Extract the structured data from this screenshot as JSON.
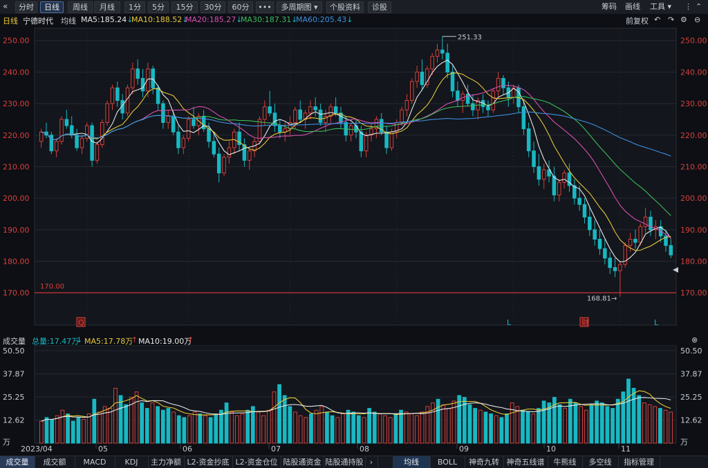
{
  "toolbar": {
    "back_icon": "double-chevron-left-icon",
    "buttons": [
      "分时",
      "日线",
      "周线",
      "月线",
      "1分",
      "5分",
      "15分",
      "30分",
      "60分"
    ],
    "active": "日线",
    "more": "•••",
    "multi_period": "多周期图",
    "stock_info": "个股资料",
    "diagnose": "诊股",
    "right_items": [
      "筹码",
      "画线",
      "工具"
    ]
  },
  "info": {
    "period": "日线",
    "stock_name": "宁德时代",
    "mode": "均线",
    "ma5": "MA5:185.24",
    "ma10": "MA10:188.52",
    "ma20": "MA20:185.27",
    "ma30": "MA30:187.31",
    "ma60": "MA60:205.43",
    "adjust": "前复权"
  },
  "colors": {
    "up": "#d7403d",
    "down": "#19b8c2",
    "ma5": "#e8e8e8",
    "ma10": "#e7c83a",
    "ma20": "#d94fb2",
    "ma30": "#3bbd5a",
    "ma60": "#3e8fe0",
    "support": "#c93636"
  },
  "annotations": {
    "high_label": "251.33",
    "low_label": "168.81",
    "support_label": "170.00",
    "markers": [
      "Q",
      "L",
      "财",
      "L"
    ]
  },
  "volume": {
    "title": "成交量",
    "total": "总量:17.47万",
    "ma5": "MA5:17.78万",
    "ma10": "MA10:19.00万"
  },
  "bottom_tabs": [
    "成交量",
    "成交额",
    "MACD",
    "KDJ",
    "主力净额",
    "L2-资金抄底",
    "L2-资金仓位",
    "陆股通资金",
    "陆股通持股"
  ],
  "bottom_tabs_right": [
    "均线",
    "BOLL",
    "神奇九转",
    "神奇五线谱",
    "牛熊线",
    "多空线",
    "指标管理"
  ],
  "chart_data": [
    {
      "type": "candlestick",
      "title": "宁德时代 日线",
      "y_ticks": [
        "250.00",
        "240.00",
        "230.00",
        "220.00",
        "210.00",
        "200.00",
        "190.00",
        "180.00",
        "170.00"
      ],
      "ylim": [
        165,
        253
      ],
      "x_ticks": [
        "2023/04",
        "05",
        "06",
        "07",
        "08",
        "09",
        "10",
        "11"
      ],
      "ohlc": [
        [
          218,
          222,
          216,
          221
        ],
        [
          221,
          224,
          219,
          220
        ],
        [
          220,
          221,
          214,
          215
        ],
        [
          215,
          219,
          213,
          218
        ],
        [
          218,
          226,
          217,
          225
        ],
        [
          225,
          228,
          222,
          223
        ],
        [
          223,
          226,
          219,
          220
        ],
        [
          220,
          222,
          215,
          216
        ],
        [
          216,
          220,
          214,
          219
        ],
        [
          219,
          224,
          218,
          223
        ],
        [
          223,
          224,
          210,
          212
        ],
        [
          212,
          218,
          211,
          217
        ],
        [
          217,
          225,
          216,
          224
        ],
        [
          224,
          231,
          223,
          230
        ],
        [
          230,
          236,
          228,
          235
        ],
        [
          235,
          237,
          229,
          231
        ],
        [
          231,
          233,
          225,
          227
        ],
        [
          227,
          236,
          226,
          235
        ],
        [
          235,
          243,
          233,
          241
        ],
        [
          241,
          244,
          236,
          238
        ],
        [
          238,
          241,
          232,
          234
        ],
        [
          234,
          243,
          232,
          241
        ],
        [
          241,
          242,
          233,
          235
        ],
        [
          235,
          236,
          228,
          230
        ],
        [
          230,
          231,
          222,
          224
        ],
        [
          224,
          228,
          222,
          226
        ],
        [
          226,
          228,
          220,
          221
        ],
        [
          221,
          223,
          214,
          216
        ],
        [
          216,
          220,
          214,
          219
        ],
        [
          219,
          226,
          218,
          225
        ],
        [
          225,
          229,
          222,
          223
        ],
        [
          223,
          227,
          220,
          226
        ],
        [
          226,
          228,
          221,
          222
        ],
        [
          222,
          224,
          216,
          218
        ],
        [
          218,
          221,
          213,
          214
        ],
        [
          214,
          216,
          205,
          208
        ],
        [
          208,
          214,
          207,
          213
        ],
        [
          213,
          218,
          211,
          216
        ],
        [
          216,
          222,
          214,
          221
        ],
        [
          221,
          224,
          215,
          217
        ],
        [
          217,
          219,
          210,
          212
        ],
        [
          212,
          216,
          209,
          215
        ],
        [
          215,
          219,
          213,
          218
        ],
        [
          218,
          226,
          217,
          225
        ],
        [
          225,
          231,
          223,
          229
        ],
        [
          229,
          234,
          226,
          227
        ],
        [
          227,
          230,
          221,
          223
        ],
        [
          223,
          225,
          219,
          221
        ],
        [
          221,
          224,
          218,
          222
        ],
        [
          222,
          226,
          220,
          224
        ],
        [
          224,
          229,
          222,
          228
        ],
        [
          228,
          231,
          224,
          225
        ],
        [
          225,
          228,
          222,
          227
        ],
        [
          227,
          231,
          225,
          229
        ],
        [
          229,
          232,
          226,
          228
        ],
        [
          228,
          230,
          223,
          224
        ],
        [
          224,
          228,
          221,
          226
        ],
        [
          226,
          230,
          224,
          229
        ],
        [
          229,
          232,
          226,
          227
        ],
        [
          227,
          229,
          222,
          224
        ],
        [
          224,
          226,
          218,
          220
        ],
        [
          220,
          224,
          218,
          223
        ],
        [
          223,
          225,
          219,
          221
        ],
        [
          221,
          223,
          213,
          215
        ],
        [
          215,
          221,
          213,
          220
        ],
        [
          220,
          224,
          218,
          222
        ],
        [
          222,
          226,
          219,
          225
        ],
        [
          225,
          227,
          220,
          221
        ],
        [
          221,
          223,
          214,
          216
        ],
        [
          216,
          222,
          215,
          221
        ],
        [
          221,
          225,
          219,
          224
        ],
        [
          224,
          229,
          223,
          228
        ],
        [
          228,
          233,
          226,
          231
        ],
        [
          231,
          238,
          230,
          237
        ],
        [
          237,
          242,
          235,
          240
        ],
        [
          240,
          244,
          234,
          236
        ],
        [
          236,
          242,
          235,
          241
        ],
        [
          241,
          246,
          239,
          245
        ],
        [
          245,
          249,
          243,
          247
        ],
        [
          247,
          251.3,
          244,
          246
        ],
        [
          246,
          249,
          238,
          240
        ],
        [
          240,
          242,
          232,
          234
        ],
        [
          234,
          237,
          229,
          231
        ],
        [
          231,
          234,
          227,
          233
        ],
        [
          233,
          236,
          229,
          230
        ],
        [
          230,
          233,
          226,
          228
        ],
        [
          228,
          232,
          225,
          231
        ],
        [
          231,
          233,
          227,
          229
        ],
        [
          229,
          231,
          226,
          228
        ],
        [
          228,
          235,
          227,
          234
        ],
        [
          234,
          240,
          232,
          238
        ],
        [
          238,
          239,
          233,
          235
        ],
        [
          235,
          237,
          229,
          232
        ],
        [
          232,
          236,
          230,
          235
        ],
        [
          235,
          236,
          227,
          229
        ],
        [
          229,
          231,
          220,
          222
        ],
        [
          222,
          224,
          213,
          215
        ],
        [
          215,
          218,
          208,
          210
        ],
        [
          210,
          214,
          204,
          206
        ],
        [
          206,
          211,
          203,
          209
        ],
        [
          209,
          212,
          205,
          207
        ],
        [
          207,
          210,
          199,
          201
        ],
        [
          201,
          206,
          199,
          205
        ],
        [
          205,
          209,
          203,
          208
        ],
        [
          208,
          211,
          202,
          204
        ],
        [
          204,
          206,
          198,
          200
        ],
        [
          200,
          204,
          196,
          198
        ],
        [
          198,
          200,
          192,
          194
        ],
        [
          194,
          197,
          188,
          190
        ],
        [
          190,
          193,
          185,
          187
        ],
        [
          187,
          190,
          182,
          184
        ],
        [
          184,
          187,
          179,
          181
        ],
        [
          181,
          183,
          176,
          178
        ],
        [
          178,
          181,
          175,
          177
        ],
        [
          177,
          180,
          168.8,
          179
        ],
        [
          179,
          186,
          178,
          185
        ],
        [
          185,
          189,
          183,
          187
        ],
        [
          187,
          190,
          184,
          186
        ],
        [
          186,
          192,
          185,
          191
        ],
        [
          191,
          197,
          189,
          194
        ],
        [
          194,
          196,
          188,
          190
        ],
        [
          190,
          193,
          187,
          191
        ],
        [
          191,
          193,
          186,
          188
        ],
        [
          188,
          190,
          183,
          185
        ],
        [
          185,
          187,
          181,
          182
        ]
      ],
      "ma_lines": {
        "MA5": "185.24",
        "MA10": "188.52",
        "MA20": "185.27",
        "MA30": "187.31",
        "MA60": "205.43"
      }
    },
    {
      "type": "bar",
      "title": "成交量",
      "y_ticks": [
        "50.50",
        "37.87",
        "25.25",
        "12.62",
        "万"
      ],
      "ylim": [
        0,
        50.5
      ],
      "values": [
        12,
        14,
        13,
        15,
        18,
        16,
        12,
        14,
        13,
        16,
        24,
        17,
        20,
        19,
        30,
        26,
        21,
        25,
        28,
        22,
        19,
        22,
        20,
        18,
        19,
        17,
        15,
        14,
        15,
        17,
        16,
        15,
        14,
        16,
        18,
        22,
        17,
        15,
        16,
        18,
        20,
        17,
        15,
        18,
        28,
        32,
        26,
        20,
        17,
        15,
        14,
        16,
        18,
        20,
        17,
        15,
        14,
        16,
        18,
        17,
        15,
        14,
        19,
        17,
        16,
        15,
        14,
        16,
        18,
        17,
        16,
        15,
        17,
        20,
        22,
        24,
        21,
        19,
        23,
        26,
        25,
        21,
        19,
        18,
        17,
        16,
        15,
        14,
        16,
        22,
        20,
        18,
        17,
        16,
        19,
        23,
        22,
        25,
        21,
        19,
        24,
        22,
        20,
        18,
        21,
        23,
        22,
        20,
        19,
        24,
        28,
        35,
        30,
        26,
        22,
        21,
        20,
        19,
        18,
        17
      ],
      "ma5_last": "17.78万",
      "ma10_last": "19.00万"
    }
  ]
}
